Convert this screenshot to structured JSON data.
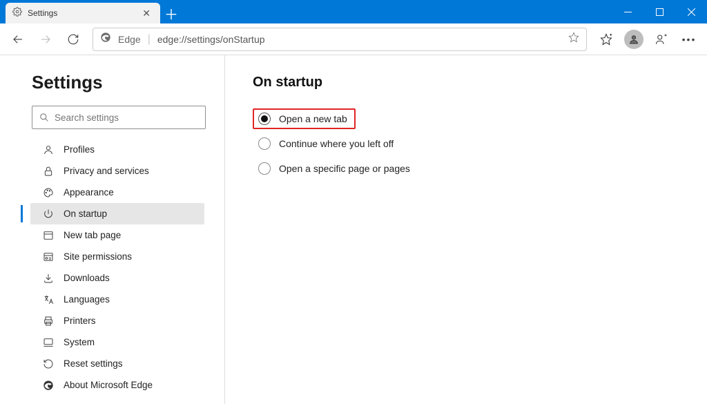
{
  "tab": {
    "label": "Settings"
  },
  "toolbar": {
    "brand": "Edge",
    "url": "edge://settings/onStartup"
  },
  "sidebar": {
    "title": "Settings",
    "search_placeholder": "Search settings",
    "items": [
      {
        "label": "Profiles"
      },
      {
        "label": "Privacy and services"
      },
      {
        "label": "Appearance"
      },
      {
        "label": "On startup"
      },
      {
        "label": "New tab page"
      },
      {
        "label": "Site permissions"
      },
      {
        "label": "Downloads"
      },
      {
        "label": "Languages"
      },
      {
        "label": "Printers"
      },
      {
        "label": "System"
      },
      {
        "label": "Reset settings"
      },
      {
        "label": "About Microsoft Edge"
      }
    ]
  },
  "main": {
    "heading": "On startup",
    "options": [
      {
        "label": "Open a new tab"
      },
      {
        "label": "Continue where you left off"
      },
      {
        "label": "Open a specific page or pages"
      }
    ]
  }
}
